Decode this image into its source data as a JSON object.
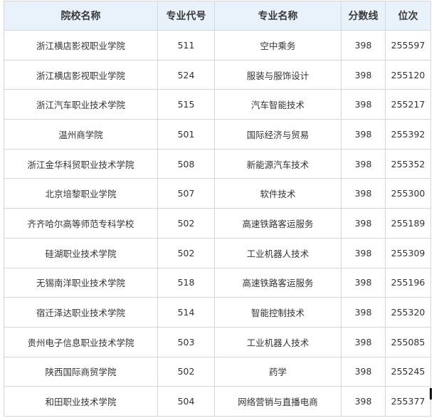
{
  "table": {
    "headers": [
      "院校名称",
      "专业代号",
      "专业名称",
      "分数线",
      "位次"
    ],
    "rows": [
      [
        "浙江横店影视职业学院",
        "511",
        "空中乘务",
        "398",
        "255597"
      ],
      [
        "浙江横店影视职业学院",
        "524",
        "服装与服饰设计",
        "398",
        "255120"
      ],
      [
        "浙江汽车职业技术学院",
        "515",
        "汽车智能技术",
        "398",
        "255217"
      ],
      [
        "温州商学院",
        "501",
        "国际经济与贸易",
        "398",
        "255392"
      ],
      [
        "浙江金华科贸职业技术学院",
        "508",
        "新能源汽车技术",
        "398",
        "255352"
      ],
      [
        "北京培黎职业学院",
        "507",
        "软件技术",
        "398",
        "255300"
      ],
      [
        "齐齐哈尔高等师范专科学校",
        "502",
        "高速铁路客运服务",
        "398",
        "255189"
      ],
      [
        "硅湖职业技术学院",
        "502",
        "工业机器人技术",
        "398",
        "255309"
      ],
      [
        "无锡南洋职业技术学院",
        "518",
        "高速铁路客运服务",
        "398",
        "255196"
      ],
      [
        "宿迁泽达职业技术学院",
        "514",
        "智能控制技术",
        "398",
        "255320"
      ],
      [
        "贵州电子信息职业技术学院",
        "503",
        "工业机器人技术",
        "398",
        "255085"
      ],
      [
        "陕西国际商贸学院",
        "502",
        "药学",
        "398",
        "255245"
      ],
      [
        "和田职业技术学院",
        "504",
        "网络营销与直播电商",
        "398",
        "255377"
      ]
    ]
  }
}
